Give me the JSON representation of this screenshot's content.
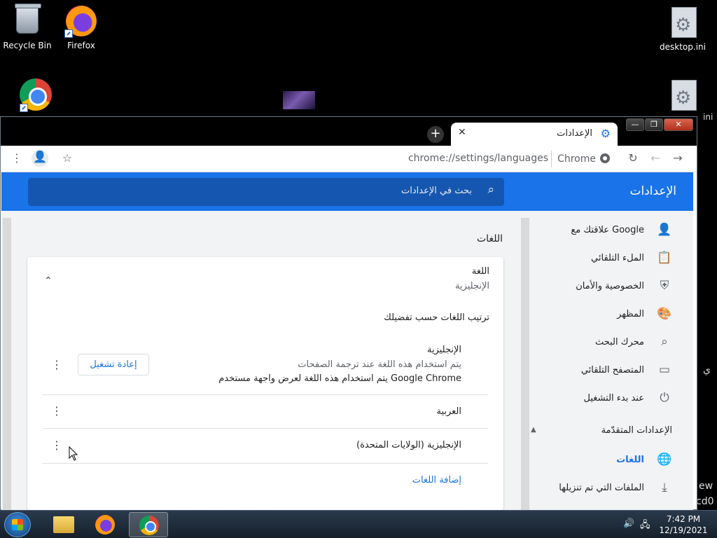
{
  "desktop": {
    "icons": [
      {
        "label": "Recycle Bin"
      },
      {
        "label": "Firefox"
      },
      {
        "label": "desktop.ini"
      },
      {
        "label": "ini"
      }
    ],
    "edge_text": [
      "ew",
      "cd0",
      "ي"
    ]
  },
  "browser": {
    "tab_title": "الإعدادات",
    "new_tab": "+",
    "url": "chrome://settings/languages",
    "site_chip": "Chrome"
  },
  "settings": {
    "title": "الإعدادات",
    "search_placeholder": "بحث في الإعدادات",
    "nav": [
      {
        "label": "علاقتك مع Google",
        "icon": "person-icon"
      },
      {
        "label": "الملء التلقائي",
        "icon": "clipboard-icon"
      },
      {
        "label": "الخصوصية والأمان",
        "icon": "shield-icon"
      },
      {
        "label": "المظهر",
        "icon": "palette-icon"
      },
      {
        "label": "محرك البحث",
        "icon": "search-icon"
      },
      {
        "label": "المتصفح التلقائي",
        "icon": "browser-icon"
      },
      {
        "label": "عند بدء التشغيل",
        "icon": "power-icon"
      }
    ],
    "advanced": {
      "label": "الإعدادات المتقدّمة",
      "items": [
        {
          "label": "اللغات",
          "icon": "globe-icon",
          "active": true
        },
        {
          "label": "الملفات التي تم تنزيلها",
          "icon": "download-icon",
          "active": false
        }
      ]
    },
    "languages_section": {
      "title": "اللغات",
      "lang_heading": "اللغة",
      "lang_value": "الإنجليزية",
      "order_heading": "ترتيب اللغات حسب تفضيلك",
      "entries": [
        {
          "name": "الإنجليزية",
          "line1": "يتم استخدام هذه اللغة عند ترجمة الصفحات",
          "line2": "يتم استخدام هذه اللغة لعرض واجهة مستخدم Google Chrome",
          "button": "إعادة تشغيل"
        },
        {
          "name": "العربية"
        },
        {
          "name": "الإنجليزية (الولايات المتحدة)"
        }
      ],
      "add_languages": "إضافة اللغات"
    }
  },
  "taskbar": {
    "time": "7:42 PM",
    "date": "12/19/2021"
  },
  "colors": {
    "accent": "#1a73e8",
    "header_bg": "#1a73e8",
    "search_bg": "#1557b0"
  }
}
